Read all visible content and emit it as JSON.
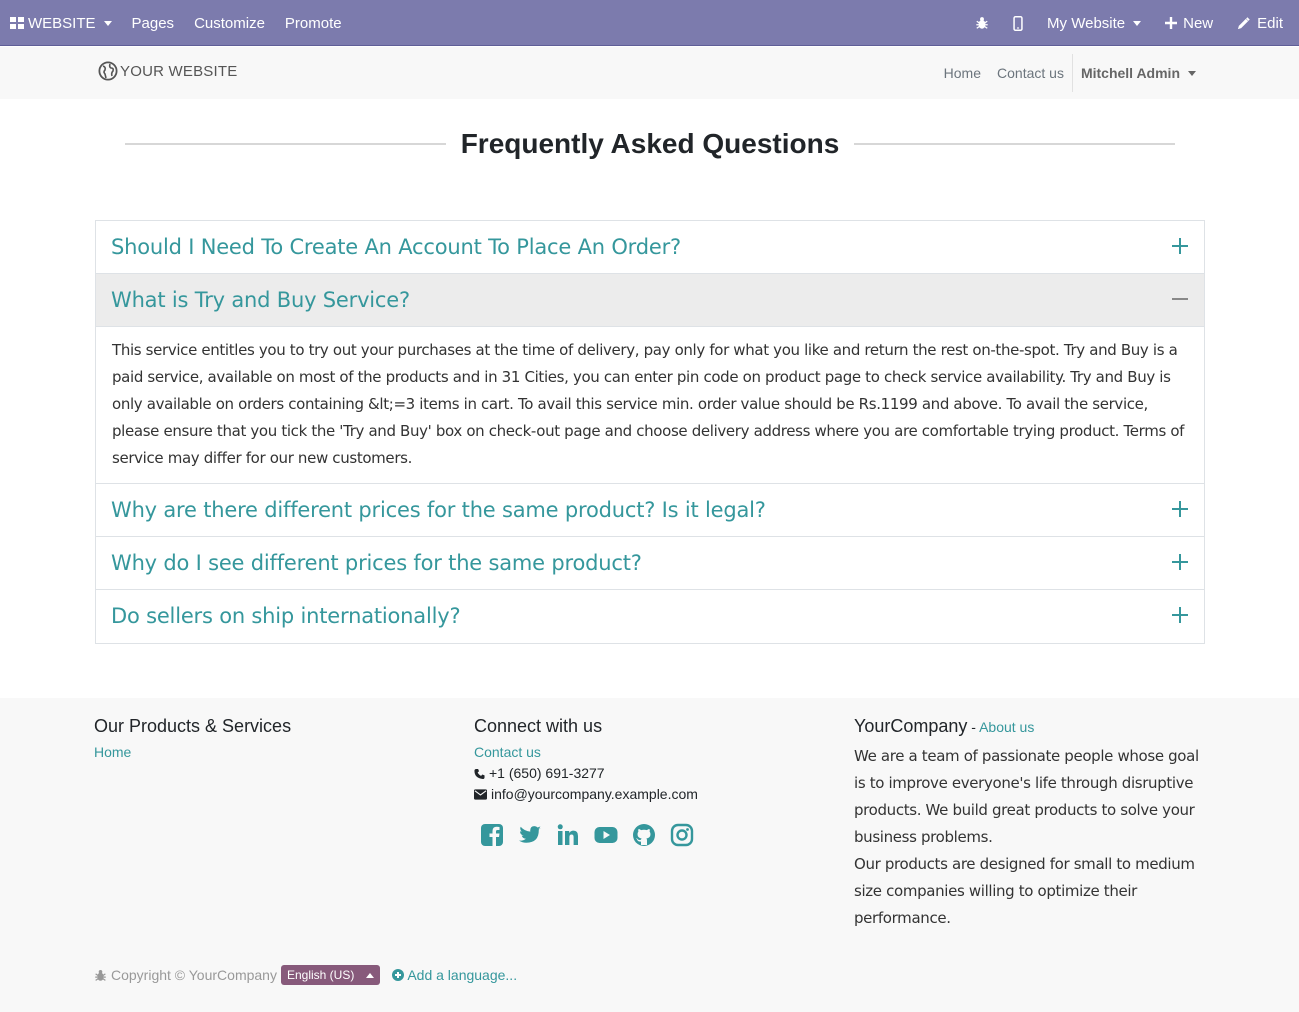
{
  "admin_bar": {
    "website_label": "WEBSITE",
    "pages_label": "Pages",
    "customize_label": "Customize",
    "promote_label": "Promote",
    "my_website_label": "My Website",
    "new_label": "New",
    "edit_label": "Edit",
    "bar_color": "#7C7BAD"
  },
  "site_header": {
    "brand": "YOUR WEBSITE",
    "nav": {
      "home": "Home",
      "contact": "Contact us",
      "user": "Mitchell Admin"
    }
  },
  "faq": {
    "title": "Frequently Asked Questions",
    "accent_color": "#35979C",
    "items": [
      {
        "question": "Should I Need To Create An Account To Place An Order?",
        "expanded": false
      },
      {
        "question": "What is Try and Buy Service?",
        "expanded": true,
        "answer": "This service entitles you to try out your purchases at the time of delivery, pay only for what you like and return the rest on-the-spot. Try and Buy is a paid service, available on most of the products and in 31 Cities, you can enter pin code on product page to check service availability. Try and Buy is only available on orders containing &lt;=3 items in cart. To avail this service min. order value should be Rs.1199 and above. To avail the service, please ensure that you tick the 'Try and Buy' box on check-out page and choose delivery address where you are comfortable trying product. Terms of service may differ for our new customers."
      },
      {
        "question": "Why are there different prices for the same product? Is it legal?",
        "expanded": false
      },
      {
        "question": "Why do I see different prices for the same product?",
        "expanded": false
      },
      {
        "question": "Do sellers on ship internationally?",
        "expanded": false
      }
    ]
  },
  "footer": {
    "products": {
      "heading": "Our Products & Services",
      "home_link": "Home"
    },
    "connect": {
      "heading": "Connect with us",
      "contact_link": "Contact us",
      "phone": "+1 (650) 691-3277",
      "email": "info@yourcompany.example.com",
      "social_icons": [
        "facebook-icon",
        "twitter-icon",
        "linkedin-icon",
        "youtube-icon",
        "github-icon",
        "instagram-icon"
      ]
    },
    "about": {
      "company": "YourCompany",
      "separator": " - ",
      "about_link": "About us",
      "paragraph1": "We are a team of passionate people whose goal is to improve everyone's life through disruptive products. We build great products to solve your business problems.",
      "paragraph2": "Our products are designed for small to medium size companies willing to optimize their performance."
    },
    "copyright": "Copyright © YourCompany",
    "language": "English (US)",
    "add_language": "Add a language...",
    "language_button_color": "#875A7B"
  }
}
